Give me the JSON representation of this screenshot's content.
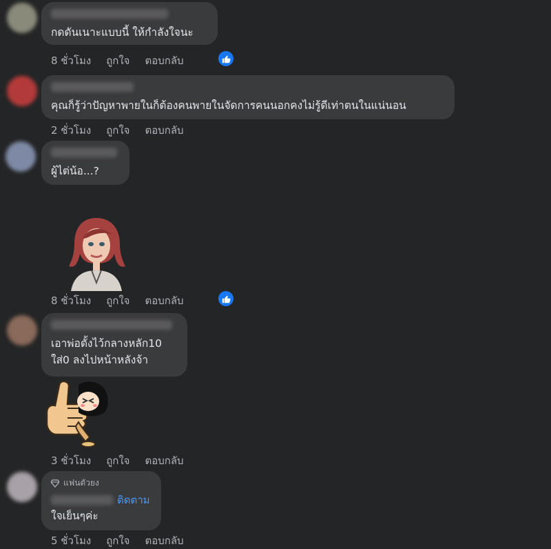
{
  "comments": [
    {
      "text": "กดดันเนาะแบบนี้ ให้กำลังใจนะ",
      "time": "8 ชั่วโมง",
      "like": "ถูกใจ",
      "reply": "ตอบกลับ"
    },
    {
      "text": "คุณก็รู้ว่าปัญหาพายในก็ต้องคนพายในจัดการคนนอกคงไม่รู้ดีเท่าตนในแน่นอน",
      "time": "2 ชั่วโมง",
      "like": "ถูกใจ",
      "reply": "ตอบกลับ"
    },
    {
      "text": "ผู้ไต่น้อ...?",
      "time": "8 ชั่วโมง",
      "like": "ถูกใจ",
      "reply": "ตอบกลับ"
    },
    {
      "line1": "เอาพ่อตั้งไว้กลางหลัก10",
      "line2": "ใส่0 ลงไปหน้าหลังจ้า",
      "time": "3 ชั่วโมง",
      "like": "ถูกใจ",
      "reply": "ตอบกลับ"
    },
    {
      "badge": "แฟนตัวยง",
      "follow": "ติดตาม",
      "text": "ใจเย็นๆค่ะ",
      "time": "5 ชั่วโมง",
      "like": "ถูกใจ",
      "reply": "ตอบกลับ"
    }
  ],
  "colors": {
    "background": "#242526",
    "bubble": "#3a3b3c",
    "link": "#4599ff",
    "like_badge": "#1877f2"
  },
  "icons": {
    "like_reaction": "thumbs-up-icon",
    "badge": "diamond-icon"
  }
}
